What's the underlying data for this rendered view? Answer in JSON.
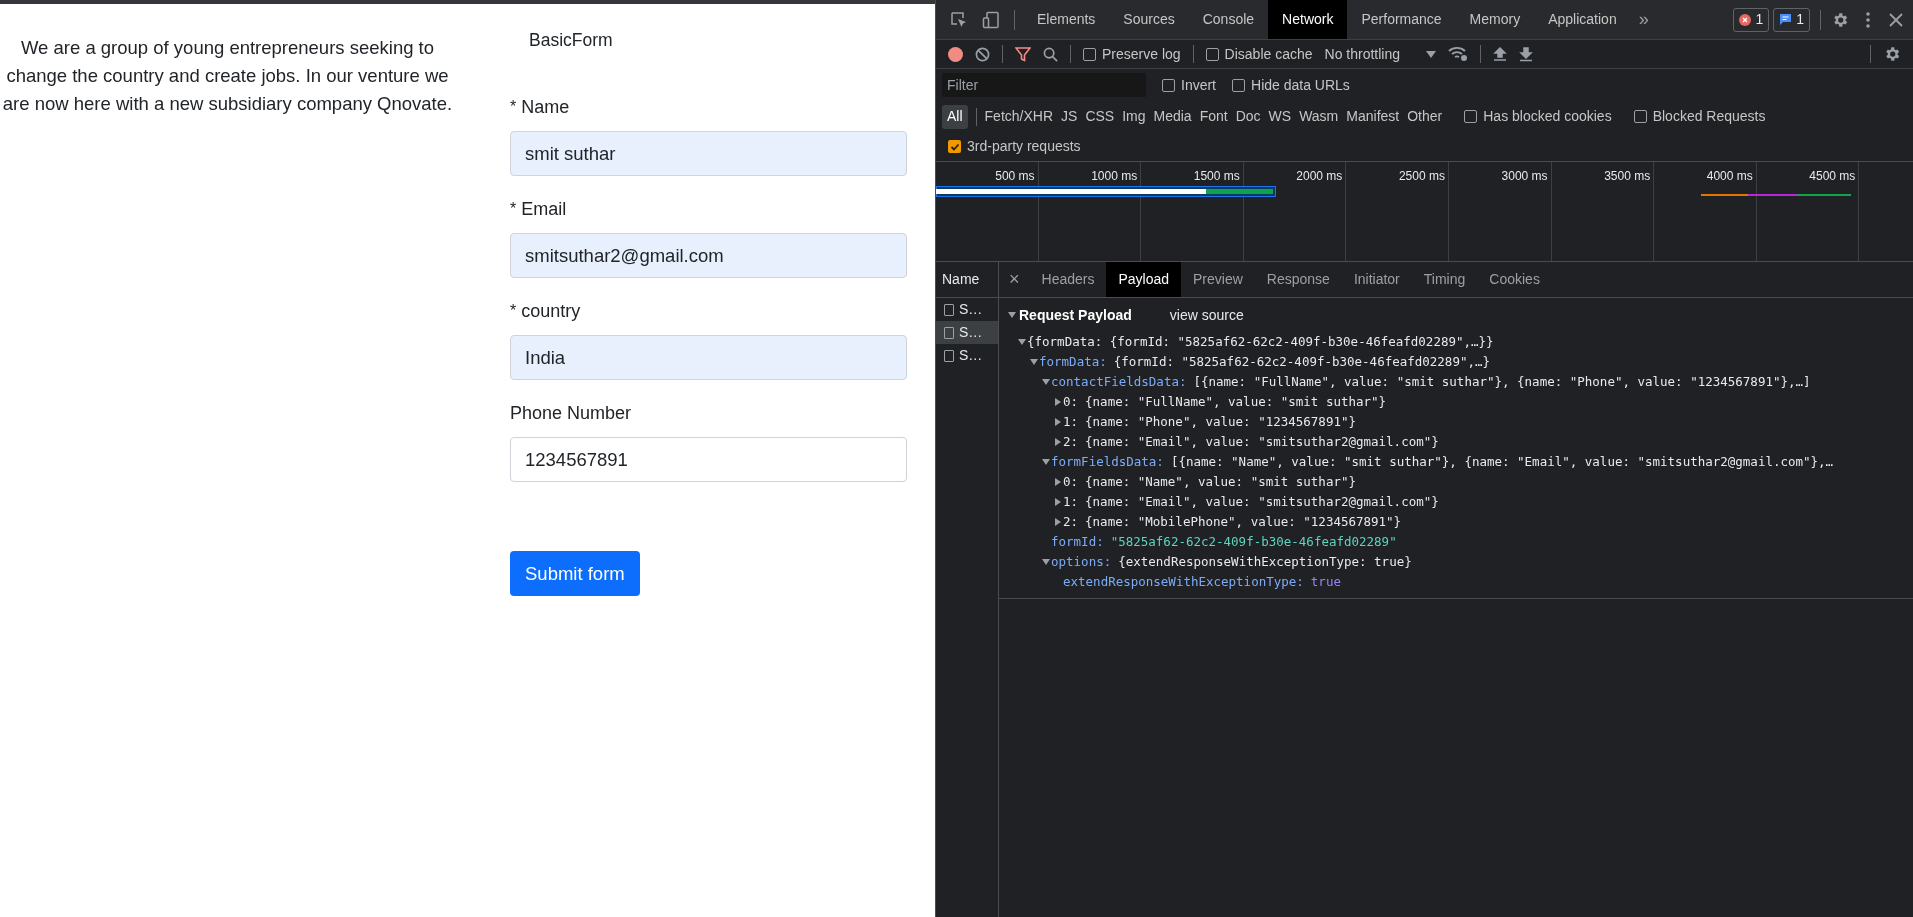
{
  "page": {
    "intro": "We are a group of young entrepreneurs seeking to change the country and create jobs. In our venture we are now here with a new subsidiary company Qnovate.",
    "form_title": "BasicForm",
    "fields": [
      {
        "label": "Name",
        "required": true,
        "value": "smit suthar",
        "autofilled": true
      },
      {
        "label": "Email",
        "required": true,
        "value": "smitsuthar2@gmail.com",
        "autofilled": true
      },
      {
        "label": "country",
        "required": true,
        "value": "India",
        "autofilled": true
      },
      {
        "label": "Phone Number",
        "required": false,
        "value": "1234567891",
        "autofilled": false
      }
    ],
    "required_mark": "*",
    "submit": "Submit form"
  },
  "devtools": {
    "tabs": [
      {
        "label": "Elements",
        "selected": false
      },
      {
        "label": "Sources",
        "selected": false
      },
      {
        "label": "Console",
        "selected": false
      },
      {
        "label": "Network",
        "selected": true
      },
      {
        "label": "Performance",
        "selected": false
      },
      {
        "label": "Memory",
        "selected": false
      },
      {
        "label": "Application",
        "selected": false
      }
    ],
    "more_tabs": "»",
    "error_count": "1",
    "message_count": "1",
    "toolbar": {
      "recording": true,
      "preserve_log": {
        "label": "Preserve log",
        "checked": false
      },
      "disable_cache": {
        "label": "Disable cache",
        "checked": false
      },
      "throttling": "No throttling"
    },
    "filter": {
      "placeholder": "Filter",
      "invert": {
        "label": "Invert",
        "checked": false
      },
      "hide_data_urls": {
        "label": "Hide data URLs",
        "checked": false
      }
    },
    "types": [
      {
        "label": "All",
        "selected": true
      },
      {
        "label": "Fetch/XHR",
        "selected": false
      },
      {
        "label": "JS",
        "selected": false
      },
      {
        "label": "CSS",
        "selected": false
      },
      {
        "label": "Img",
        "selected": false
      },
      {
        "label": "Media",
        "selected": false
      },
      {
        "label": "Font",
        "selected": false
      },
      {
        "label": "Doc",
        "selected": false
      },
      {
        "label": "WS",
        "selected": false
      },
      {
        "label": "Wasm",
        "selected": false
      },
      {
        "label": "Manifest",
        "selected": false
      },
      {
        "label": "Other",
        "selected": false
      }
    ],
    "blocked_cookies": {
      "label": "Has blocked cookies",
      "checked": false
    },
    "blocked_requests": {
      "label": "Blocked Requests",
      "checked": false
    },
    "third_party": {
      "label": "3rd-party requests",
      "checked": true
    },
    "timeline_ticks": [
      "500 ms",
      "1000 ms",
      "1500 ms",
      "2000 ms",
      "2500 ms",
      "3000 ms",
      "3500 ms",
      "4000 ms",
      "4500 ms"
    ],
    "name_header": "Name",
    "requests": [
      {
        "name": "S…",
        "selected": false
      },
      {
        "name": "S…",
        "selected": true
      },
      {
        "name": "S…",
        "selected": false
      }
    ],
    "close": "×",
    "detail_tabs": [
      {
        "label": "Headers",
        "selected": false
      },
      {
        "label": "Payload",
        "selected": true
      },
      {
        "label": "Preview",
        "selected": false
      },
      {
        "label": "Response",
        "selected": false
      },
      {
        "label": "Initiator",
        "selected": false
      },
      {
        "label": "Timing",
        "selected": false
      },
      {
        "label": "Cookies",
        "selected": false
      }
    ],
    "payload": {
      "title": "Request Payload",
      "view_source": "view source",
      "expanded": true,
      "tree": [
        {
          "kind": "object",
          "value": "{formData: {formId: \"5825af62-62c2-409f-b30e-46feafd02289\",…}}",
          "expanded": true,
          "children": [
            {
              "kind": "object",
              "key": "formData:",
              "value": "{formId: \"5825af62-62c2-409f-b30e-46feafd02289\",…}",
              "expanded": true,
              "children": [
                {
                  "kind": "object",
                  "key": "contactFieldsData:",
                  "value": "[{name: \"FullName\", value: \"smit suthar\"}, {name: \"Phone\", value: \"1234567891\"},…]",
                  "expanded": true,
                  "children": [
                    {
                      "kind": "object",
                      "key": "0:",
                      "index": true,
                      "value": "{name: \"FullName\", value: \"smit suthar\"}",
                      "expanded": false
                    },
                    {
                      "kind": "object",
                      "key": "1:",
                      "index": true,
                      "value": "{name: \"Phone\", value: \"1234567891\"}",
                      "expanded": false
                    },
                    {
                      "kind": "object",
                      "key": "2:",
                      "index": true,
                      "value": "{name: \"Email\", value: \"smitsuthar2@gmail.com\"}",
                      "expanded": false
                    }
                  ]
                },
                {
                  "kind": "object",
                  "key": "formFieldsData:",
                  "value": "[{name: \"Name\", value: \"smit suthar\"}, {name: \"Email\", value: \"smitsuthar2@gmail.com\"},…",
                  "expanded": true,
                  "children": [
                    {
                      "kind": "object",
                      "key": "0:",
                      "index": true,
                      "value": "{name: \"Name\", value: \"smit suthar\"}",
                      "expanded": false
                    },
                    {
                      "kind": "object",
                      "key": "1:",
                      "index": true,
                      "value": "{name: \"Email\", value: \"smitsuthar2@gmail.com\"}",
                      "expanded": false
                    },
                    {
                      "kind": "object",
                      "key": "2:",
                      "index": true,
                      "value": "{name: \"MobilePhone\", value: \"1234567891\"}",
                      "expanded": false
                    }
                  ]
                },
                {
                  "kind": "string",
                  "key": "formId:",
                  "value": "\"5825af62-62c2-409f-b30e-46feafd02289\""
                },
                {
                  "kind": "object",
                  "key": "options:",
                  "value": "{extendResponseWithExceptionType: true}",
                  "expanded": true,
                  "children": [
                    {
                      "kind": "boolean",
                      "key": "extendResponseWithExceptionType:",
                      "value": "true"
                    }
                  ]
                }
              ]
            }
          ]
        }
      ]
    }
  }
}
